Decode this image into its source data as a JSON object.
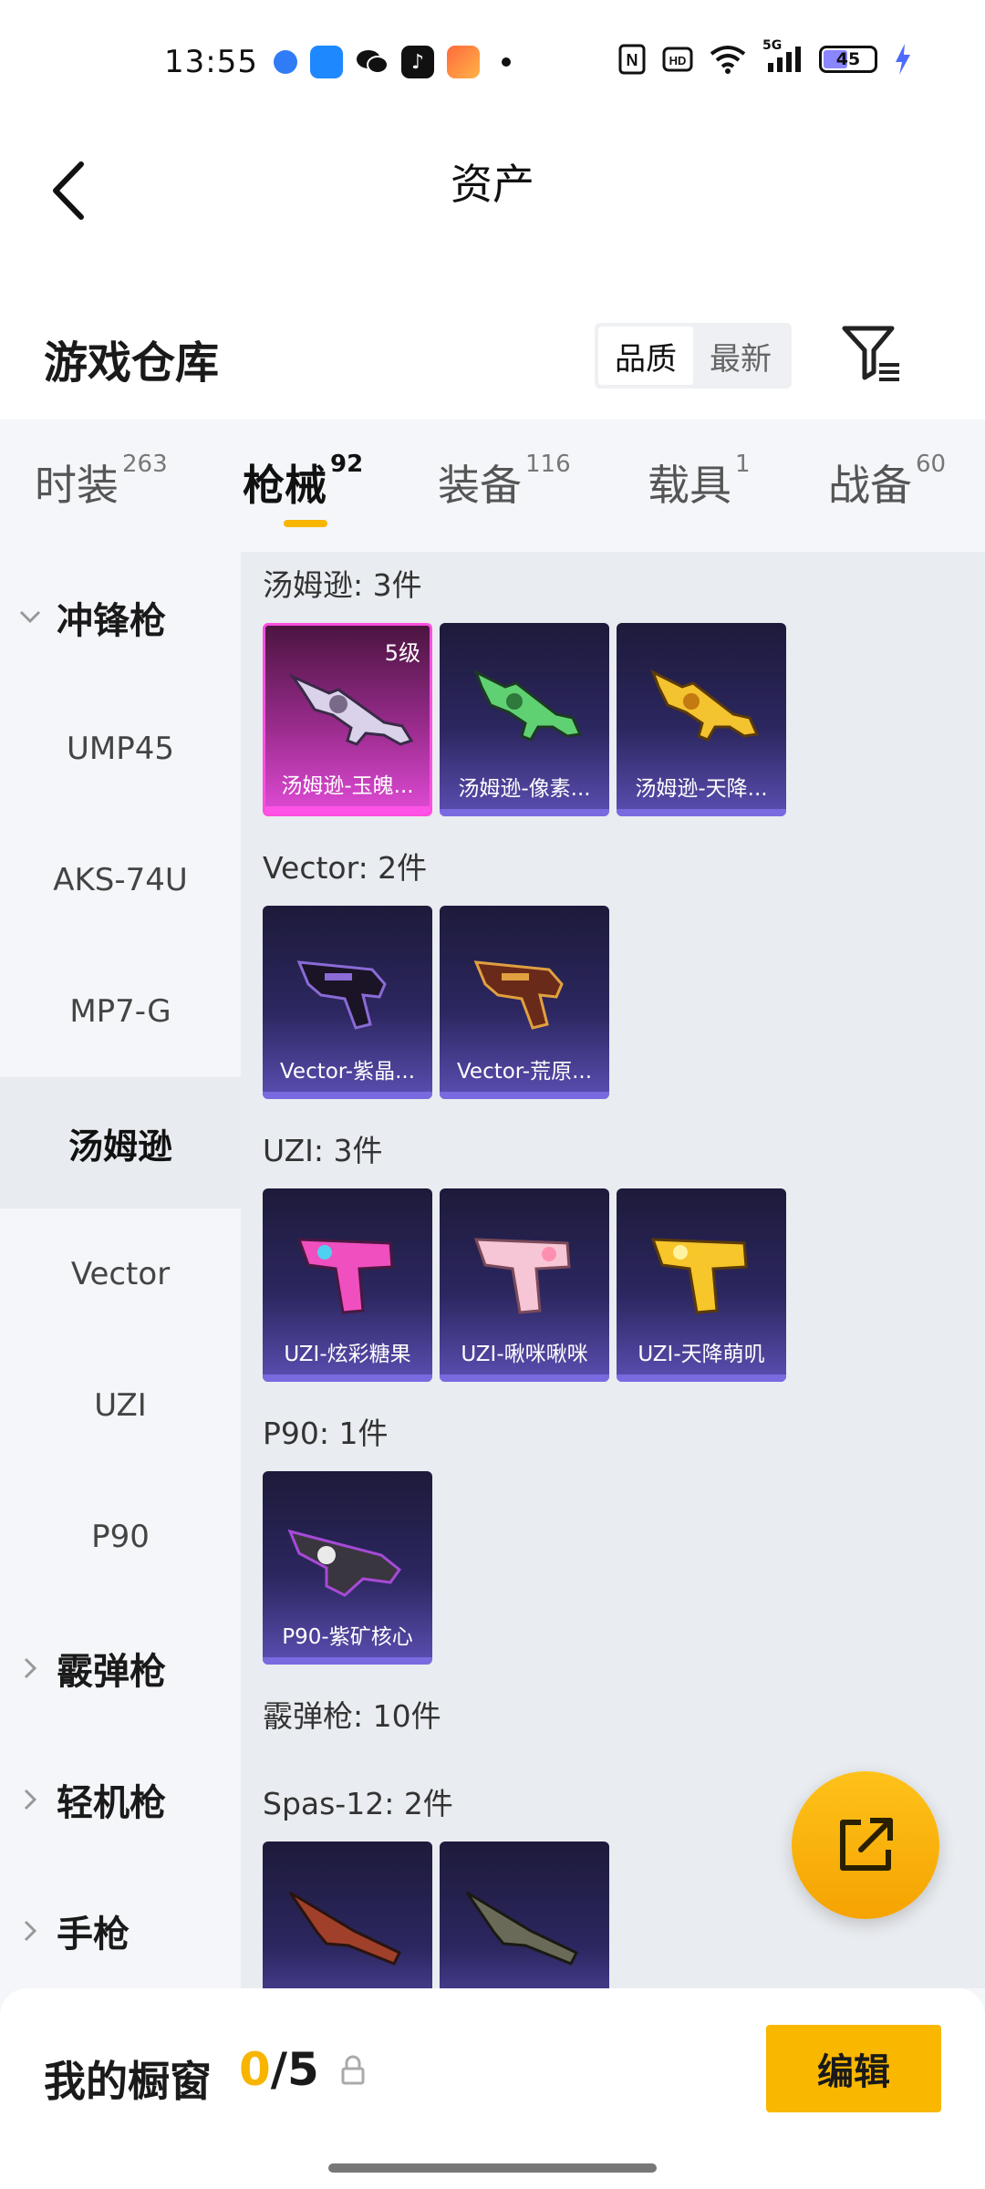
{
  "status_bar": {
    "time": "13:55",
    "battery": "45",
    "network": "5G",
    "icons": [
      "nfc-icon",
      "hd-icon",
      "wifi-icon",
      "signal-icon",
      "battery-icon",
      "charging-icon"
    ]
  },
  "header": {
    "title": "资产"
  },
  "section": {
    "title": "游戏仓库",
    "sort_options": [
      "品质",
      "最新"
    ],
    "active_sort": "品质"
  },
  "tabs": [
    {
      "label": "时装",
      "count": "263"
    },
    {
      "label": "枪械",
      "count": "92",
      "active": true
    },
    {
      "label": "装备",
      "count": "116"
    },
    {
      "label": "载具",
      "count": "1"
    },
    {
      "label": "战备",
      "count": "60"
    }
  ],
  "sidebar": {
    "group_smg": "冲锋枪",
    "items": [
      "UMP45",
      "AKS-74U",
      "MP7-G",
      "汤姆逊",
      "Vector",
      "UZI",
      "P90"
    ],
    "active_item": "汤姆逊",
    "group_shotgun": "霰弹枪",
    "group_lmg": "轻机枪",
    "group_pistol": "手枪"
  },
  "content": {
    "thompson": {
      "label": "汤姆逊: 3件",
      "items": [
        {
          "name": "汤姆逊-玉魄...",
          "level": "5级",
          "accent": "#e04bd6"
        },
        {
          "name": "汤姆逊-像素...",
          "accent": "#5b4fb3"
        },
        {
          "name": "汤姆逊-天降...",
          "accent": "#5b4fb3"
        }
      ]
    },
    "vector": {
      "label": "Vector: 2件",
      "items": [
        {
          "name": "Vector-紫晶...",
          "accent": "#5b4fb3"
        },
        {
          "name": "Vector-荒原...",
          "accent": "#5b4fb3"
        }
      ]
    },
    "uzi": {
      "label": "UZI: 3件",
      "items": [
        {
          "name": "UZI-炫彩糖果",
          "accent": "#5b4fb3"
        },
        {
          "name": "UZI-啾咪啾咪",
          "accent": "#5b4fb3"
        },
        {
          "name": "UZI-天降萌叽",
          "accent": "#5b4fb3"
        }
      ]
    },
    "p90": {
      "label": "P90: 1件",
      "items": [
        {
          "name": "P90-紫矿核心",
          "accent": "#5b4fb3"
        }
      ]
    },
    "shotgun_label": "霰弹枪: 10件",
    "spas": {
      "label": "Spas-12: 2件",
      "items": [
        {
          "name": "",
          "accent": "#5b4fb3"
        },
        {
          "name": "",
          "accent": "#5b4fb3"
        }
      ]
    }
  },
  "bottom": {
    "showcase_label": "我的橱窗",
    "showcase_current": "0",
    "showcase_total": "/5",
    "edit_label": "编辑"
  },
  "colors": {
    "accent": "#f7b500",
    "rare_purple": "#5b4fb3",
    "legendary_pink": "#e04bd6"
  }
}
